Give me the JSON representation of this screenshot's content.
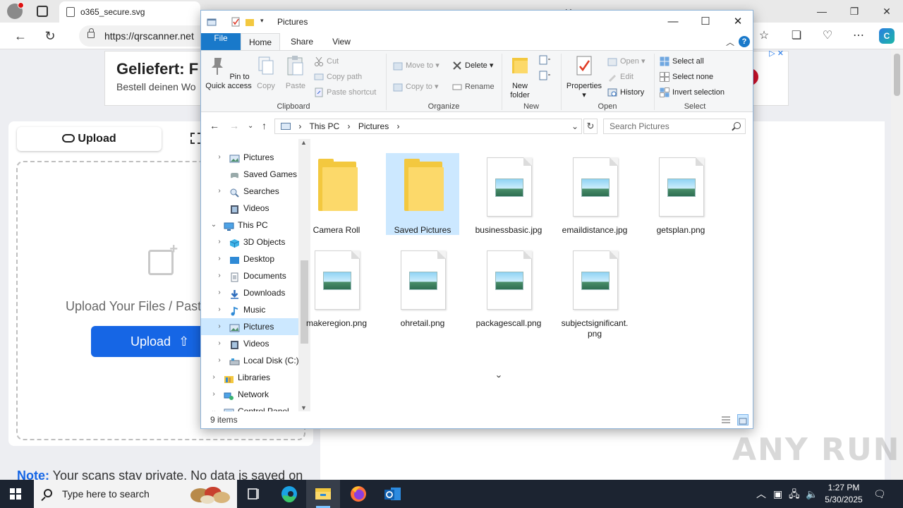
{
  "browser": {
    "tabs": [
      {
        "title": "o365_secure.svg",
        "active": true
      },
      {
        "title": "",
        "active": false
      },
      {
        "title": "",
        "active": false
      }
    ],
    "url": "https://qrscanner.net"
  },
  "webpage": {
    "ad": {
      "title": "Geliefert: F",
      "subtitle": "Bestell deinen Wo"
    },
    "upload_tab": "Upload",
    "drop_text": "Upload Your Files / Paste",
    "upload_button": "Upload",
    "note_label": "Note:",
    "note_text": " Your scans stay private. No data is saved on"
  },
  "explorer": {
    "title": "Pictures",
    "ribbon_tabs": {
      "file": "File",
      "home": "Home",
      "share": "Share",
      "view": "View"
    },
    "clipboard": {
      "group": "Clipboard",
      "pin": "Pin to Quick access",
      "copy": "Copy",
      "paste": "Paste",
      "cut": "Cut",
      "copy_path": "Copy path",
      "paste_shortcut": "Paste shortcut"
    },
    "organize": {
      "group": "Organize",
      "move_to": "Move to",
      "copy_to": "Copy to",
      "delete": "Delete",
      "rename": "Rename"
    },
    "new": {
      "group": "New",
      "new_folder": "New folder"
    },
    "open": {
      "group": "Open",
      "properties": "Properties",
      "open": "Open",
      "edit": "Edit",
      "history": "History"
    },
    "select": {
      "group": "Select",
      "select_all": "Select all",
      "select_none": "Select none",
      "invert": "Invert selection"
    },
    "breadcrumb": {
      "root": "This PC",
      "current": "Pictures"
    },
    "search_placeholder": "Search Pictures",
    "tree": [
      {
        "label": "Pictures",
        "indent": 2,
        "chev": "›",
        "icon": "pictures"
      },
      {
        "label": "Saved Games",
        "indent": 2,
        "chev": "",
        "icon": "games"
      },
      {
        "label": "Searches",
        "indent": 2,
        "chev": "›",
        "icon": "search"
      },
      {
        "label": "Videos",
        "indent": 2,
        "chev": "",
        "icon": "video"
      },
      {
        "label": "This PC",
        "indent": 1,
        "chev": "⌄",
        "icon": "pc"
      },
      {
        "label": "3D Objects",
        "indent": 2,
        "chev": "›",
        "icon": "3d"
      },
      {
        "label": "Desktop",
        "indent": 2,
        "chev": "›",
        "icon": "desktop"
      },
      {
        "label": "Documents",
        "indent": 2,
        "chev": "›",
        "icon": "docs"
      },
      {
        "label": "Downloads",
        "indent": 2,
        "chev": "›",
        "icon": "downloads"
      },
      {
        "label": "Music",
        "indent": 2,
        "chev": "›",
        "icon": "music"
      },
      {
        "label": "Pictures",
        "indent": 2,
        "chev": "›",
        "icon": "pictures",
        "selected": true
      },
      {
        "label": "Videos",
        "indent": 2,
        "chev": "›",
        "icon": "video"
      },
      {
        "label": "Local Disk (C:)",
        "indent": 2,
        "chev": "›",
        "icon": "disk"
      },
      {
        "label": "Libraries",
        "indent": 1,
        "chev": "›",
        "icon": "libraries"
      },
      {
        "label": "Network",
        "indent": 1,
        "chev": "›",
        "icon": "network"
      },
      {
        "label": "Control Panel",
        "indent": 1,
        "chev": "⌄",
        "icon": "control"
      }
    ],
    "files": [
      {
        "name": "Camera Roll",
        "type": "folder"
      },
      {
        "name": "Saved Pictures",
        "type": "folder",
        "selected": true
      },
      {
        "name": "businessbasic.jpg",
        "type": "image"
      },
      {
        "name": "emaildistance.jpg",
        "type": "image"
      },
      {
        "name": "getsplan.png",
        "type": "image"
      },
      {
        "name": "makeregion.png",
        "type": "image"
      },
      {
        "name": "ohretail.png",
        "type": "image"
      },
      {
        "name": "packagescall.png",
        "type": "image"
      },
      {
        "name": "subjectsignificant.png",
        "type": "image"
      }
    ],
    "status": "9 items"
  },
  "taskbar": {
    "search_placeholder": "Type here to search",
    "time": "1:27 PM",
    "date": "5/30/2025"
  },
  "watermark": "ANY RUN",
  "colors": {
    "accent": "#1979ca",
    "selection": "#cce8ff",
    "folder": "#f3c83f",
    "upload": "#1666e5",
    "taskbar": "#1c2431"
  }
}
